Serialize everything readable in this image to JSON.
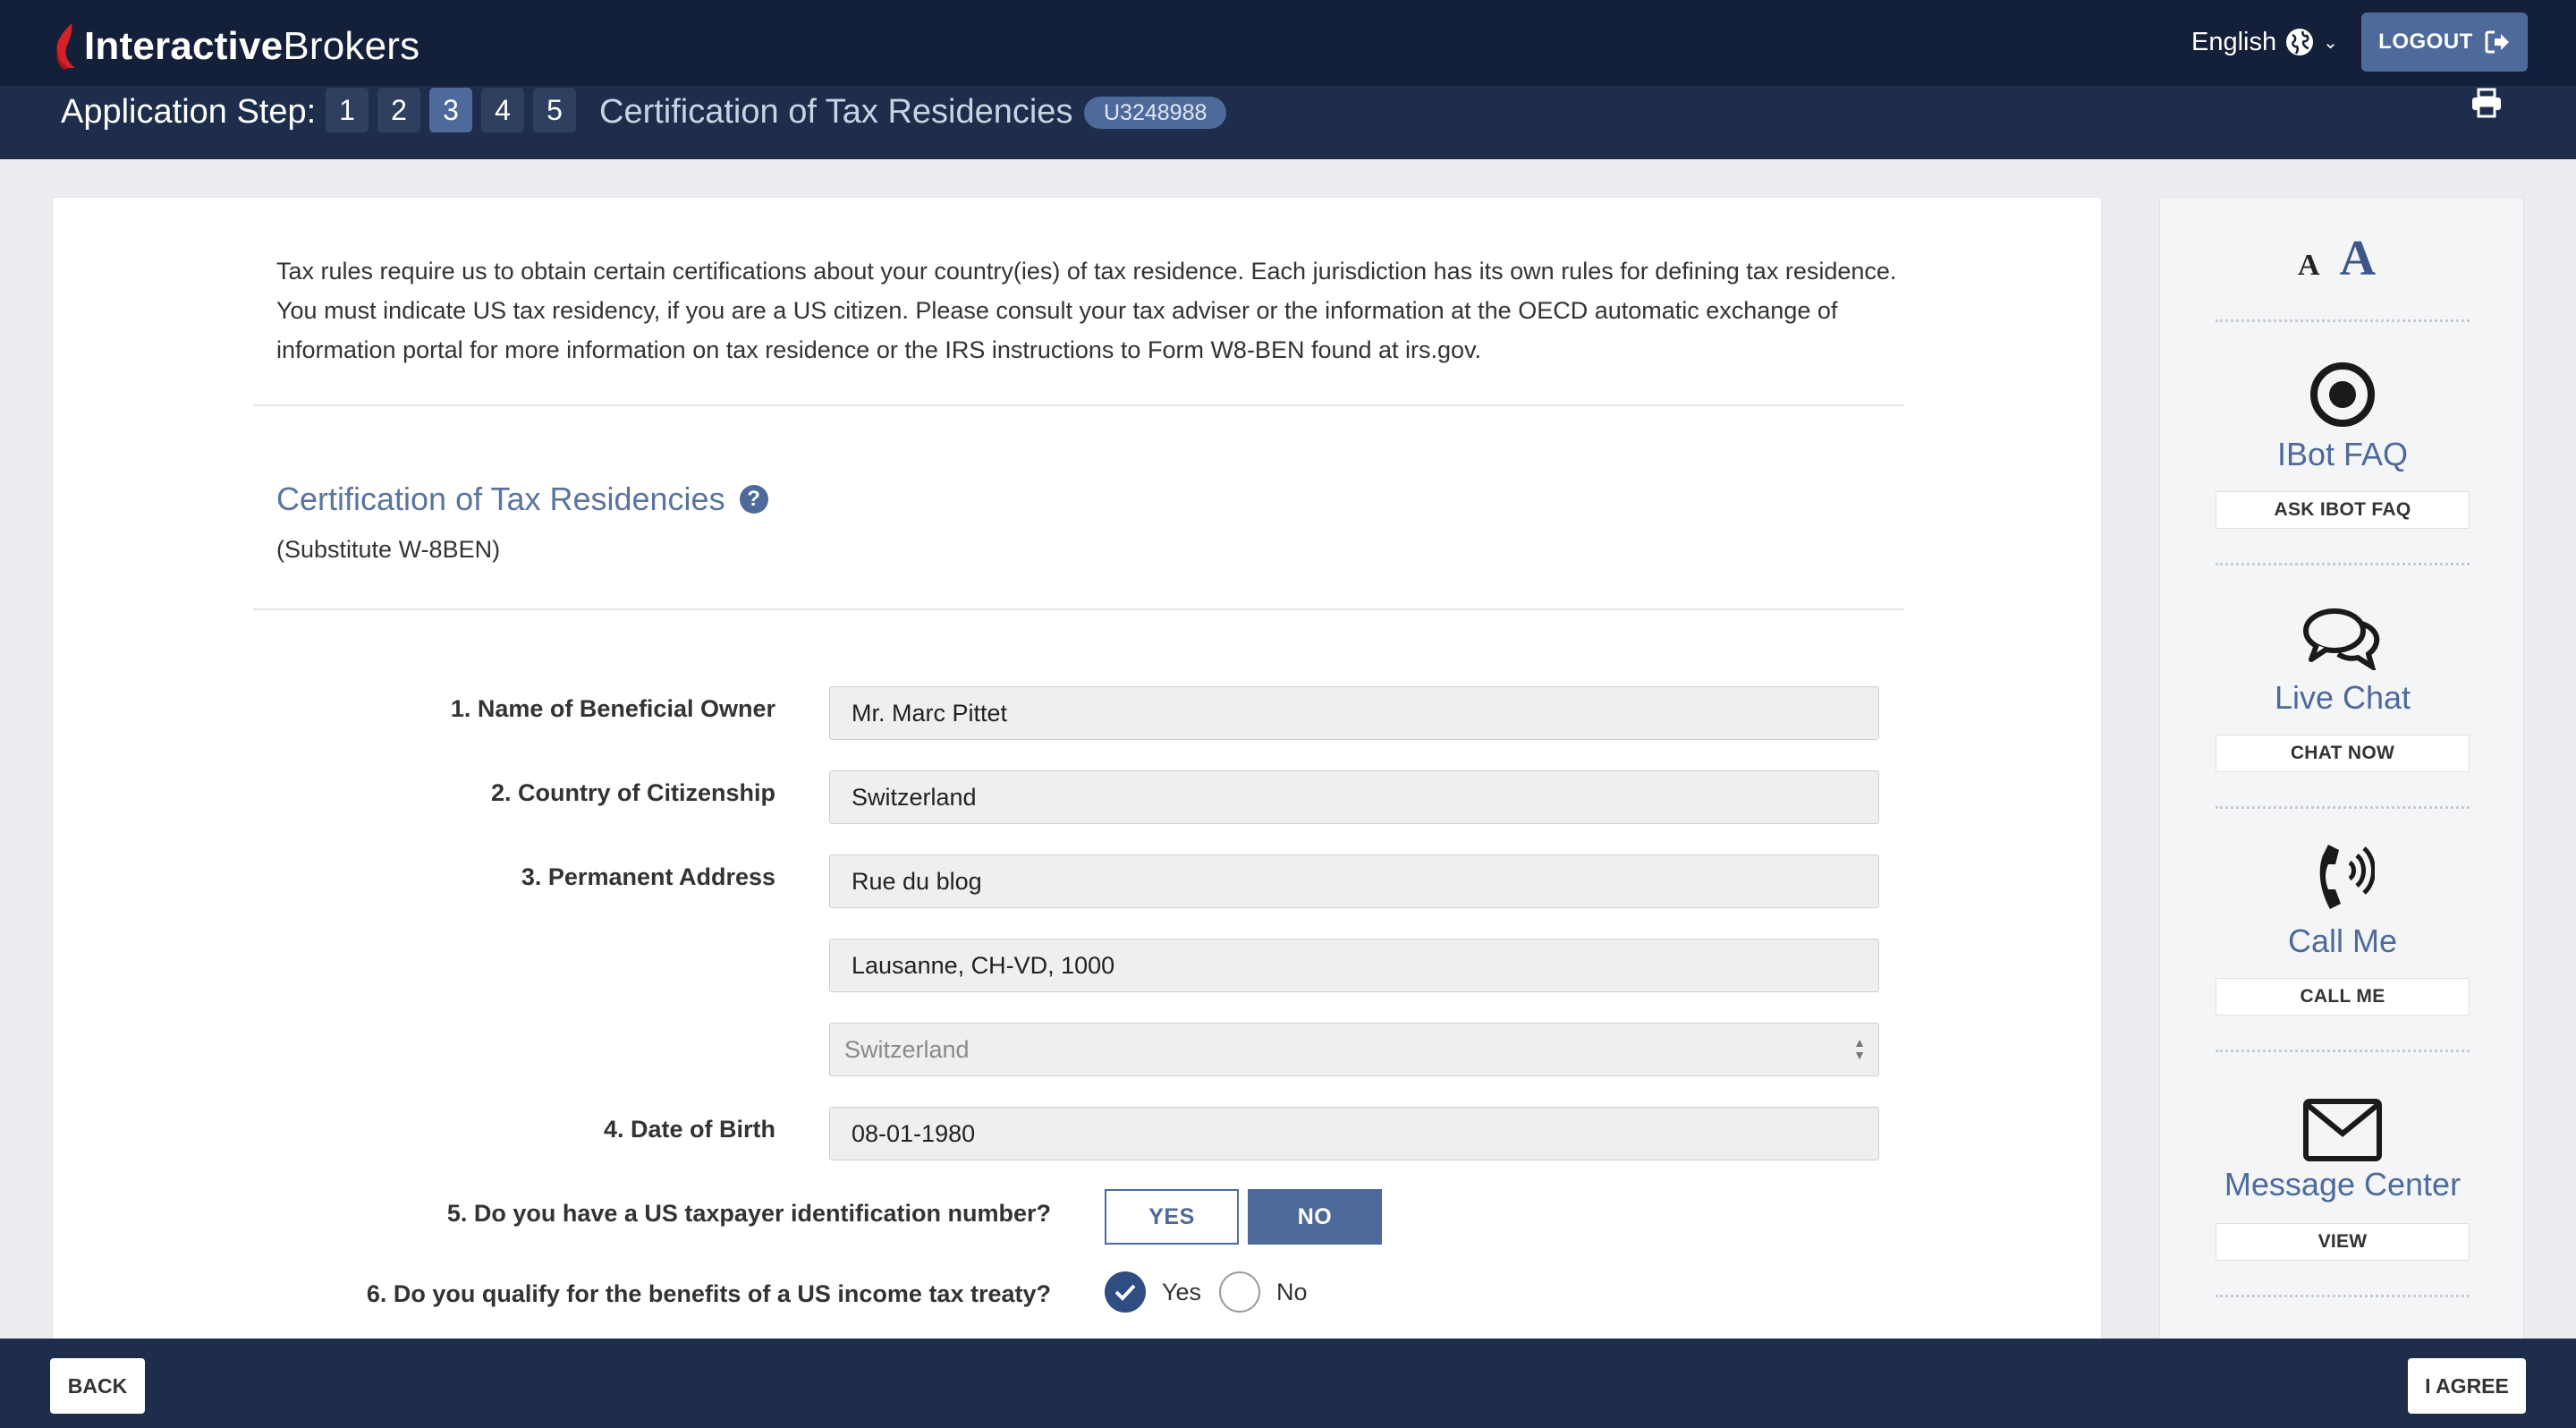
{
  "header": {
    "brand_bold": "Interactive",
    "brand_light": "Brokers",
    "language": "English",
    "logout_label": "LOGOUT"
  },
  "stepbar": {
    "label": "Application Step:",
    "steps": [
      "1",
      "2",
      "3",
      "4",
      "5"
    ],
    "active_step": 3,
    "title": "Certification of Tax Residencies",
    "account_id": "U3248988"
  },
  "main": {
    "intro": "Tax rules require us to obtain certain certifications about your country(ies) of tax residence. Each jurisdiction has its own rules for defining tax residence. You must indicate US tax residency, if you are a US citizen. Please consult your tax adviser or the information at the OECD automatic exchange of information portal for more information on tax residence or the IRS instructions to Form W8-BEN found at irs.gov.",
    "section_title": "Certification of Tax Residencies",
    "section_subtitle": "(Substitute W-8BEN)",
    "fields": {
      "name_label": "1. Name of Beneficial Owner",
      "name_value": "Mr. Marc Pittet",
      "citizenship_label": "2. Country of Citizenship",
      "citizenship_value": "Switzerland",
      "address_label": "3. Permanent Address",
      "address_line1": "Rue du blog",
      "address_line2": "Lausanne, CH-VD, 1000",
      "address_country": "Switzerland",
      "dob_label": "4. Date of Birth",
      "dob_value": "08-01-1980"
    },
    "q5": {
      "label": "5. Do you have a US taxpayer identification number?",
      "yes": "YES",
      "no": "NO",
      "selected": "NO"
    },
    "q6": {
      "label": "6. Do you qualify for the benefits of a US income tax treaty?",
      "yes": "Yes",
      "no": "No",
      "selected": "Yes"
    }
  },
  "sidebar": {
    "font_small": "A",
    "font_big": "A",
    "ibot_title": "IBot FAQ",
    "ibot_button": "ASK IBOT FAQ",
    "chat_title": "Live Chat",
    "chat_button": "CHAT NOW",
    "call_title": "Call Me",
    "call_button": "CALL ME",
    "message_title": "Message Center",
    "message_button": "VIEW"
  },
  "footer": {
    "back_label": "BACK",
    "agree_label": "I AGREE"
  },
  "colors": {
    "header_bg": "#142039",
    "stepbar_bg": "#1d2d4b",
    "accent": "#4e6a9b",
    "brand_red": "#d62027"
  }
}
